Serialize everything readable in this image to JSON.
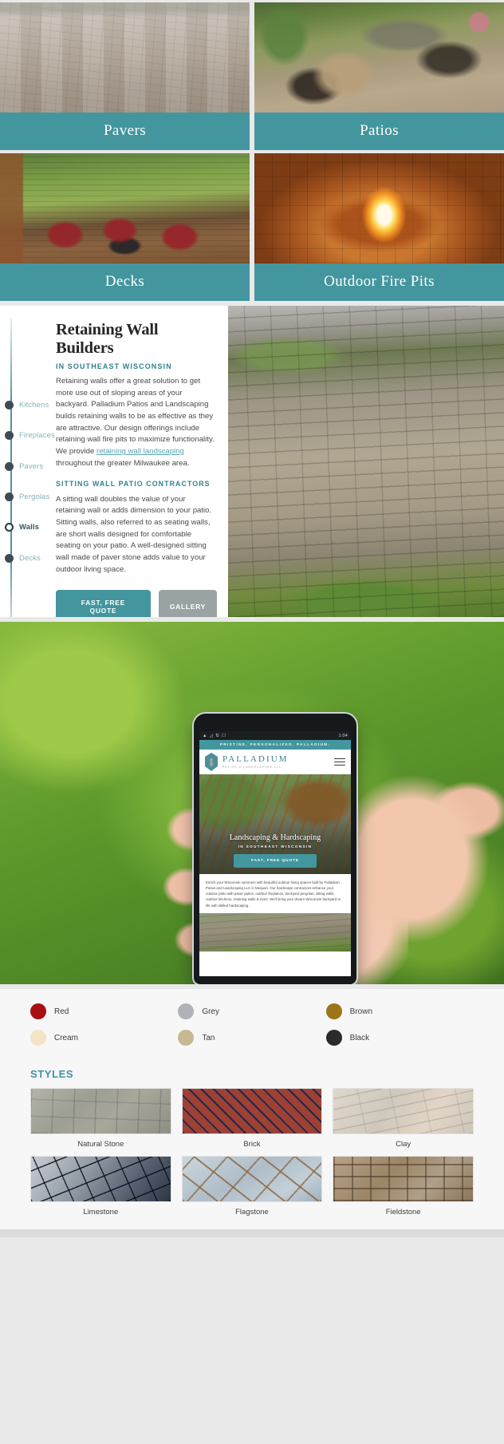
{
  "categories": [
    {
      "label": "Pavers",
      "texture": "img-pavers"
    },
    {
      "label": "Patios",
      "texture": "img-patios"
    },
    {
      "label": "Decks",
      "texture": "img-decks"
    },
    {
      "label": "Outdoor Fire Pits",
      "texture": "img-firepit"
    }
  ],
  "retaining_wall": {
    "timeline": [
      {
        "label": "Kitchens",
        "active": false
      },
      {
        "label": "Fireplaces",
        "active": false
      },
      {
        "label": "Pavers",
        "active": false
      },
      {
        "label": "Pergolas",
        "active": false
      },
      {
        "label": "Walls",
        "active": true
      },
      {
        "label": "Decks",
        "active": false
      }
    ],
    "title": "Retaining Wall Builders",
    "subtitle": "IN SOUTHEAST WISCONSIN",
    "paragraph_before_link": "Retaining walls offer a great solution to get more use out of sloping areas of your backyard. Palladium Patios and Landscaping builds retaining walls to be as effective as they are attractive. Our design offerings include retaining wall fire pits to maximize functionality. We provide ",
    "paragraph_link": "retaining wall landscaping",
    "paragraph_after_link": " throughout the greater Milwaukee area.",
    "heading2": "SITTING WALL PATIO CONTRACTORS",
    "paragraph2": "A sitting wall doubles the value of your retaining wall or adds dimension to your patio. Sitting walls, also referred to as seating walls, are short walls designed for comfortable seating on your patio. A well-designed sitting wall made of paver stone adds value to your outdoor living space.",
    "primary_button": "FAST, FREE QUOTE",
    "secondary_button": "GALLERY"
  },
  "phone": {
    "status_time": "1:04",
    "tagline": "PRISTINE. PERSONALIZED. PALLADIUM.",
    "logo_name": "PALLADIUM",
    "logo_tagline": "PATIOS & LANDSCAPING LLC",
    "hero_title": "Landscaping & Hardscaping",
    "hero_subtitle": "IN SOUTHEAST WISCONSIN",
    "hero_button": "FAST, FREE QUOTE",
    "body_text": "Enrich your Wisconsin summers with beautiful outdoor living spaces built by Palladium Patios and Landscaping LLC in Mequon. Our hardscape contractors enhance your outdoor patio with paver patios, outdoor fireplaces, backyard pergolas, sitting walls, outdoor kitchens, retaining walls & more. We'll bring your dream Wisconsin backyard to life with skilled hardscaping."
  },
  "colors": [
    {
      "name": "Red",
      "hex": "#a70f12"
    },
    {
      "name": "Grey",
      "hex": "#b0b2b7"
    },
    {
      "name": "Brown",
      "hex": "#9c7516"
    },
    {
      "name": "Cream",
      "hex": "#f4e3c6"
    },
    {
      "name": "Tan",
      "hex": "#c8b991"
    },
    {
      "name": "Black",
      "hex": "#2b2b2b"
    }
  ],
  "styles": {
    "heading": "STYLES",
    "items": [
      {
        "name": "Natural Stone",
        "texture": "tex-natural"
      },
      {
        "name": "Brick",
        "texture": "tex-brick"
      },
      {
        "name": "Clay",
        "texture": "tex-clay"
      },
      {
        "name": "Limestone",
        "texture": "tex-limestone"
      },
      {
        "name": "Flagstone",
        "texture": "tex-flagstone"
      },
      {
        "name": "Fieldstone",
        "texture": "tex-fieldstone"
      }
    ]
  },
  "theme": {
    "teal": "#43969e",
    "teal_dark": "#2f818f",
    "grey_button": "#9aa3a3"
  }
}
